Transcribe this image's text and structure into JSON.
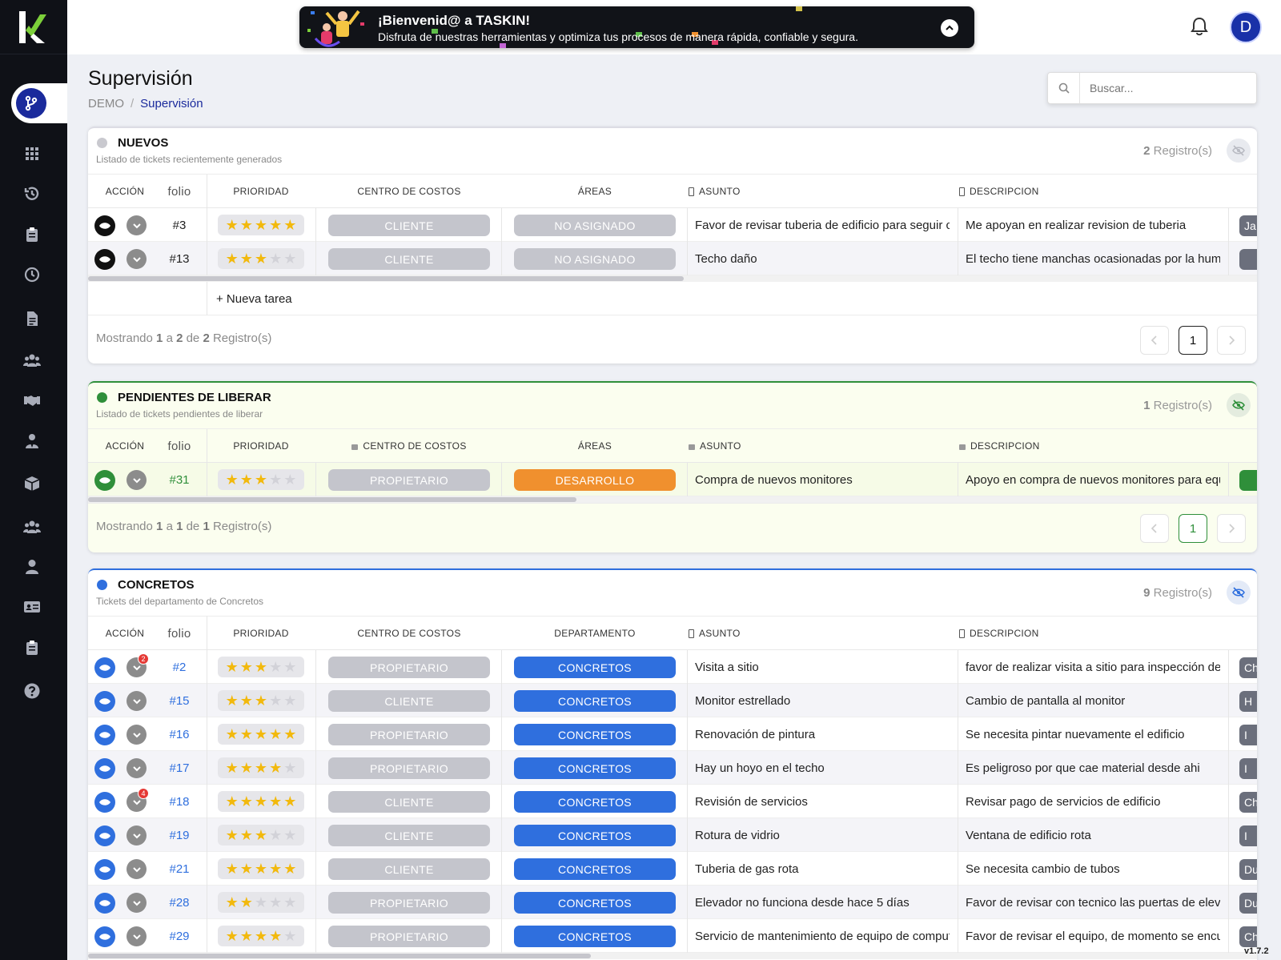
{
  "app": {
    "name": "TASKIN",
    "version": "v1.7.2"
  },
  "banner": {
    "title": "¡Bienvenid@ a TASKIN!",
    "subtitle": "Disfruta de nuestras herramientas y optimiza tus procesos de manera rápida, confiable y segura."
  },
  "user": {
    "avatar_letter": "D"
  },
  "page": {
    "title": "Supervisión"
  },
  "breadcrumb": {
    "root": "DEMO",
    "sep": "/",
    "current": "Supervisión"
  },
  "search": {
    "placeholder": "Buscar..."
  },
  "sidebar": {
    "items": [
      "branch-icon",
      "apps-grid-icon",
      "history-icon",
      "clipboard-icon",
      "clock-icon",
      "document-icon",
      "users-icon",
      "handshake-icon",
      "user-tie-icon",
      "box-icon",
      "team-icon",
      "user-icon",
      "id-card-icon",
      "clipboard-check-icon",
      "help-icon"
    ]
  },
  "colors": {
    "accent": "#1a2a9c",
    "green": "#2f8f3a",
    "blue": "#2f6fde",
    "orange": "#f0902e",
    "gray_pill": "#c4c5cc"
  },
  "nuevos": {
    "title": "NUEVOS",
    "subtitle": "Listado de tickets recientemente generados",
    "count": "2",
    "count_label": "Registro(s)",
    "headers": {
      "accion": "ACCIÓN",
      "folio": "folio",
      "prioridad": "PRIORIDAD",
      "centro": "CENTRO DE COSTOS",
      "area": "ÁREAS",
      "asunto": "ASUNTO",
      "descripcion": "DESCRIPCION"
    },
    "rows": [
      {
        "folio": "#3",
        "stars": 5,
        "centro": "CLIENTE",
        "area": "NO ASIGNADO",
        "asunto": "Favor de revisar tuberia de edificio para seguir con las labores",
        "descripcion": "Me apoyan en realizar revision de tuberia",
        "tag": "Ja"
      },
      {
        "folio": "#13",
        "stars": 3,
        "centro": "CLIENTE",
        "area": "NO ASIGNADO",
        "asunto": "Techo daño",
        "descripcion": "El techo tiene manchas ocasionadas por la humedad",
        "tag": ""
      }
    ],
    "new_task": "+ Nueva tarea",
    "footer": {
      "showing": "Mostrando",
      "from": "1",
      "a": "a",
      "to": "2",
      "de": "de",
      "total": "2",
      "label": "Registro(s)"
    },
    "page": "1"
  },
  "pendientes": {
    "title": "PENDIENTES DE LIBERAR",
    "subtitle": "Listado de tickets pendientes de liberar",
    "count": "1",
    "count_label": "Registro(s)",
    "headers": {
      "accion": "ACCIÓN",
      "folio": "folio",
      "prioridad": "PRIORIDAD",
      "centro": "CENTRO DE COSTOS",
      "area": "ÁREAS",
      "asunto": "ASUNTO",
      "descripcion": "DESCRIPCION"
    },
    "rows": [
      {
        "folio": "#31",
        "stars": 3,
        "centro": "PROPIETARIO",
        "area": "DESARROLLO",
        "asunto": "Compra de nuevos monitores",
        "descripcion": "Apoyo en compra de nuevos monitores para equipo",
        "tag": ""
      }
    ],
    "footer": {
      "showing": "Mostrando",
      "from": "1",
      "a": "a",
      "to": "1",
      "de": "de",
      "total": "1",
      "label": "Registro(s)"
    },
    "page": "1"
  },
  "concretos": {
    "title": "CONCRETOS",
    "subtitle": "Tickets del departamento de Concretos",
    "count": "9",
    "count_label": "Registro(s)",
    "headers": {
      "accion": "ACCIÓN",
      "folio": "folio",
      "prioridad": "PRIORIDAD",
      "centro": "CENTRO DE COSTOS",
      "area": "DEPARTAMENTO",
      "asunto": "ASUNTO",
      "descripcion": "DESCRIPCION"
    },
    "rows": [
      {
        "folio": "#2",
        "stars": 3,
        "centro": "PROPIETARIO",
        "area": "CONCRETOS",
        "asunto": "Visita a sitio",
        "descripcion": "favor de realizar visita a sitio para inspección de obra",
        "tag": "Ch",
        "badge": "2"
      },
      {
        "folio": "#15",
        "stars": 3,
        "centro": "CLIENTE",
        "area": "CONCRETOS",
        "asunto": "Monitor estrellado",
        "descripcion": "Cambio de pantalla al monitor",
        "tag": "H",
        "badge": ""
      },
      {
        "folio": "#16",
        "stars": 5,
        "centro": "PROPIETARIO",
        "area": "CONCRETOS",
        "asunto": "Renovación de pintura",
        "descripcion": "Se necesita pintar nuevamente el edificio",
        "tag": "I",
        "badge": ""
      },
      {
        "folio": "#17",
        "stars": 4,
        "centro": "PROPIETARIO",
        "area": "CONCRETOS",
        "asunto": "Hay un hoyo en el techo",
        "descripcion": "Es peligroso por que cae material desde ahi",
        "tag": "I",
        "badge": ""
      },
      {
        "folio": "#18",
        "stars": 5,
        "centro": "CLIENTE",
        "area": "CONCRETOS",
        "asunto": "Revisión de servicios",
        "descripcion": "Revisar pago de servicios de edificio",
        "tag": "Ch",
        "badge": "4"
      },
      {
        "folio": "#19",
        "stars": 3,
        "centro": "CLIENTE",
        "area": "CONCRETOS",
        "asunto": "Rotura de vidrio",
        "descripcion": "Ventana de edificio rota",
        "tag": "I",
        "badge": ""
      },
      {
        "folio": "#21",
        "stars": 5,
        "centro": "CLIENTE",
        "area": "CONCRETOS",
        "asunto": "Tuberia de gas rota",
        "descripcion": "Se necesita cambio de tubos",
        "tag": "Du",
        "badge": ""
      },
      {
        "folio": "#28",
        "stars": 2,
        "centro": "PROPIETARIO",
        "area": "CONCRETOS",
        "asunto": "Elevador no funciona desde hace 5 días",
        "descripcion": "Favor de revisar con tecnico las puertas de elevador",
        "tag": "Du",
        "badge": ""
      },
      {
        "folio": "#29",
        "stars": 4,
        "centro": "PROPIETARIO",
        "area": "CONCRETOS",
        "asunto": "Servicio de mantenimiento de equipo de computo",
        "descripcion": "Favor de revisar el equipo, de momento se encuentra lento",
        "tag": "Ch",
        "badge": ""
      }
    ]
  }
}
